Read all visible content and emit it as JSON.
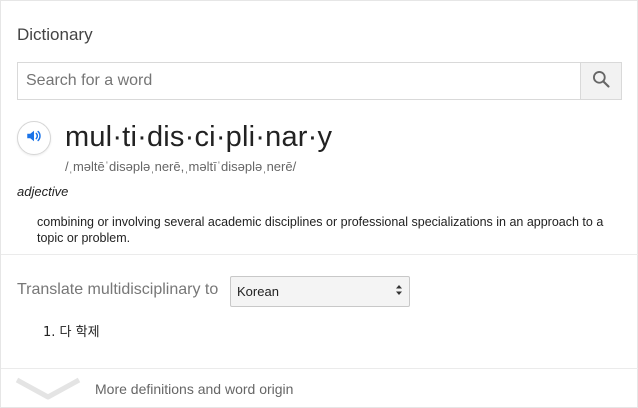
{
  "widget": {
    "title": "Dictionary"
  },
  "search": {
    "placeholder": "Search for a word",
    "value": "",
    "icon": "search-icon"
  },
  "entry": {
    "audio_icon": "speaker-icon",
    "headword": "mul·ti·dis·ci·pli·nar·y",
    "phonetic": "/ˌməltēˈdisəpləˌnerē,ˌməltīˈdisəpləˌnerē/",
    "part_of_speech": "adjective",
    "definition": "combining or involving several academic disciplines or professional specializations in an approach to a topic or problem."
  },
  "translate": {
    "label": "Translate multidisciplinary to",
    "selected_language": "Korean",
    "select_icon": "up-down-arrows-icon",
    "results": [
      {
        "number": "1.",
        "text": "다 학제"
      }
    ]
  },
  "footer": {
    "more_icon": "chevron-down-icon",
    "more_label": "More definitions and word origin"
  },
  "colors": {
    "accent": "#1a73e8",
    "text": "#222222",
    "muted": "#777777"
  }
}
